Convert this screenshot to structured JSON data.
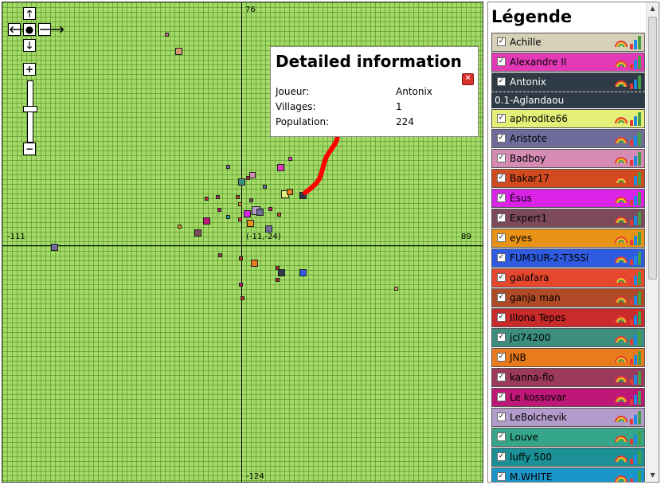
{
  "map": {
    "axes": {
      "top": "76",
      "bottom": "-124",
      "left": "-111",
      "right": "89",
      "center": "(-11,-24)"
    },
    "controls": {
      "up": "🡑",
      "left": "🡐",
      "center": "●",
      "right": "🡒",
      "down": "🡓",
      "zoom_in": "+",
      "zoom_out": "−"
    },
    "info": {
      "title": "Detailed information",
      "close": "×",
      "rows": [
        {
          "label": "Joueur:",
          "value": "Antonix"
        },
        {
          "label": "Villages:",
          "value": "1"
        },
        {
          "label": "Population:",
          "value": "224"
        }
      ]
    }
  },
  "legend": {
    "title": "Légende",
    "check": "✓",
    "rainbow_icon": "rainbow-icon",
    "stats_icon": "bar-chart-icon",
    "players": [
      {
        "name": "Achille",
        "color": "#d6d1b8"
      },
      {
        "name": "Alexandre II",
        "color": "#e23ab6"
      },
      {
        "name": "Antonix",
        "color": "#2e3a45",
        "sub": "0.1-Aglandaou"
      },
      {
        "name": "aphrodite66",
        "color": "#e4ef7a"
      },
      {
        "name": "Aristote",
        "color": "#6f6c9c"
      },
      {
        "name": "Badboy",
        "color": "#d68bb5"
      },
      {
        "name": "Bakar17",
        "color": "#d24a1f"
      },
      {
        "name": "Ésus",
        "color": "#db23e8"
      },
      {
        "name": "Expert1",
        "color": "#7d4a5c"
      },
      {
        "name": "eyes",
        "color": "#e89317"
      },
      {
        "name": "FUM3UR-2-T3SSi",
        "color": "#2f5be0"
      },
      {
        "name": "galafara",
        "color": "#e7482d"
      },
      {
        "name": "ganja man",
        "color": "#b04a26"
      },
      {
        "name": "Illona Tepes",
        "color": "#c92a2a"
      },
      {
        "name": "jcl74200",
        "color": "#3c8f7e"
      },
      {
        "name": "JNB",
        "color": "#e87b1b"
      },
      {
        "name": "kanna-flo",
        "color": "#9c3a5e"
      },
      {
        "name": "Le kossovar",
        "color": "#bd1778"
      },
      {
        "name": "LeBolchevik",
        "color": "#b39ccc"
      },
      {
        "name": "Louve",
        "color": "#35a68a"
      },
      {
        "name": "luffy 500",
        "color": "#1b9096"
      },
      {
        "name": "M.WHITE",
        "color": "#1b96c8"
      }
    ]
  }
}
